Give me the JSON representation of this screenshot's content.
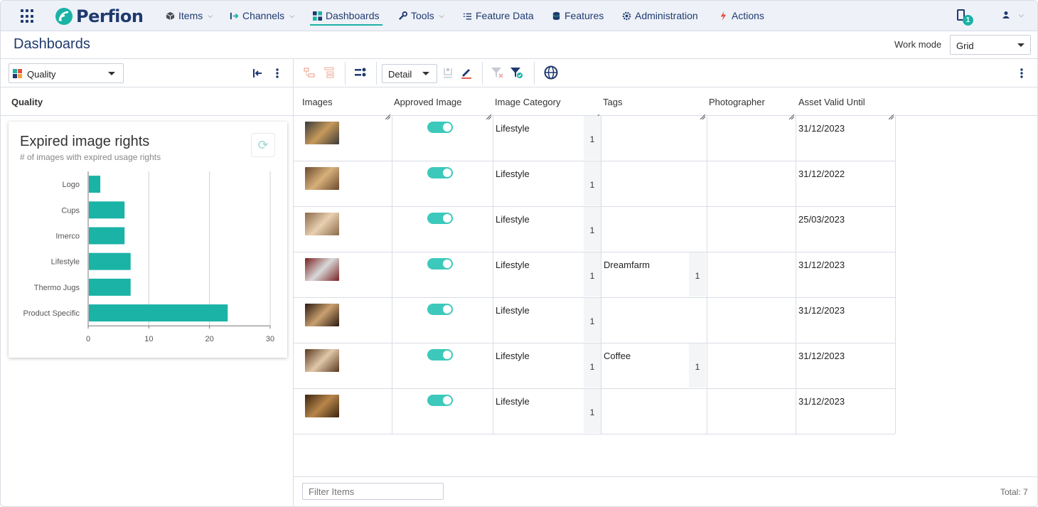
{
  "nav": {
    "logo": "Perfion",
    "items": [
      {
        "label": "Items",
        "icon": "cube-icon",
        "dropdown": true
      },
      {
        "label": "Channels",
        "icon": "channel-arrow-icon",
        "dropdown": true
      },
      {
        "label": "Dashboards",
        "icon": "dashboard-icon",
        "dropdown": false,
        "active": true
      },
      {
        "label": "Tools",
        "icon": "wrench-icon",
        "dropdown": true
      },
      {
        "label": "Feature Data",
        "icon": "list-icon",
        "dropdown": false
      },
      {
        "label": "Features",
        "icon": "database-icon",
        "dropdown": false
      },
      {
        "label": "Administration",
        "icon": "gear-icon",
        "dropdown": false
      },
      {
        "label": "Actions",
        "icon": "lightning-icon",
        "dropdown": false
      }
    ],
    "notification_count": "1"
  },
  "header": {
    "title": "Dashboards",
    "work_mode_label": "Work mode",
    "work_mode_value": "Grid"
  },
  "left_panel": {
    "selected_dashboard": "Quality",
    "section_header": "Quality",
    "card": {
      "title": "Expired image rights",
      "subtitle": "# of images with expired usage rights"
    }
  },
  "chart_data": {
    "type": "bar",
    "orientation": "horizontal",
    "title": "Expired image rights",
    "subtitle": "# of images with expired usage rights",
    "categories": [
      "Logo",
      "Cups",
      "Imerco",
      "Lifestyle",
      "Thermo Jugs",
      "Product Specific"
    ],
    "values": [
      2,
      6,
      6,
      7,
      7,
      23
    ],
    "xlim": [
      0,
      30
    ],
    "xticks": [
      0,
      10,
      20,
      30
    ],
    "grid": true,
    "color": "#1ab3a6"
  },
  "toolbar": {
    "view_select": "Detail"
  },
  "grid": {
    "columns": [
      "Images",
      "Approved Image",
      "Image Category",
      "Tags",
      "Photographer",
      "Asset Valid Until"
    ],
    "rows": [
      {
        "category": "Lifestyle",
        "category_count": "1",
        "tag": "",
        "tag_count": "",
        "photographer": "",
        "valid_until": "31/12/2023",
        "approved": true
      },
      {
        "category": "Lifestyle",
        "category_count": "1",
        "tag": "",
        "tag_count": "",
        "photographer": "",
        "valid_until": "31/12/2022",
        "approved": true
      },
      {
        "category": "Lifestyle",
        "category_count": "1",
        "tag": "",
        "tag_count": "",
        "photographer": "",
        "valid_until": "25/03/2023",
        "approved": true
      },
      {
        "category": "Lifestyle",
        "category_count": "1",
        "tag": "Dreamfarm",
        "tag_count": "1",
        "photographer": "",
        "valid_until": "31/12/2023",
        "approved": true
      },
      {
        "category": "Lifestyle",
        "category_count": "1",
        "tag": "",
        "tag_count": "",
        "photographer": "",
        "valid_until": "31/12/2023",
        "approved": true
      },
      {
        "category": "Lifestyle",
        "category_count": "1",
        "tag": "Coffee",
        "tag_count": "1",
        "photographer": "",
        "valid_until": "31/12/2023",
        "approved": true
      },
      {
        "category": "Lifestyle",
        "category_count": "1",
        "tag": "",
        "tag_count": "",
        "photographer": "",
        "valid_until": "31/12/2023",
        "approved": true
      }
    ],
    "filter_placeholder": "Filter Items",
    "total": "Total: 7"
  },
  "colors": {
    "accent": "#1ab3a6",
    "brand": "#1f3a6e"
  }
}
